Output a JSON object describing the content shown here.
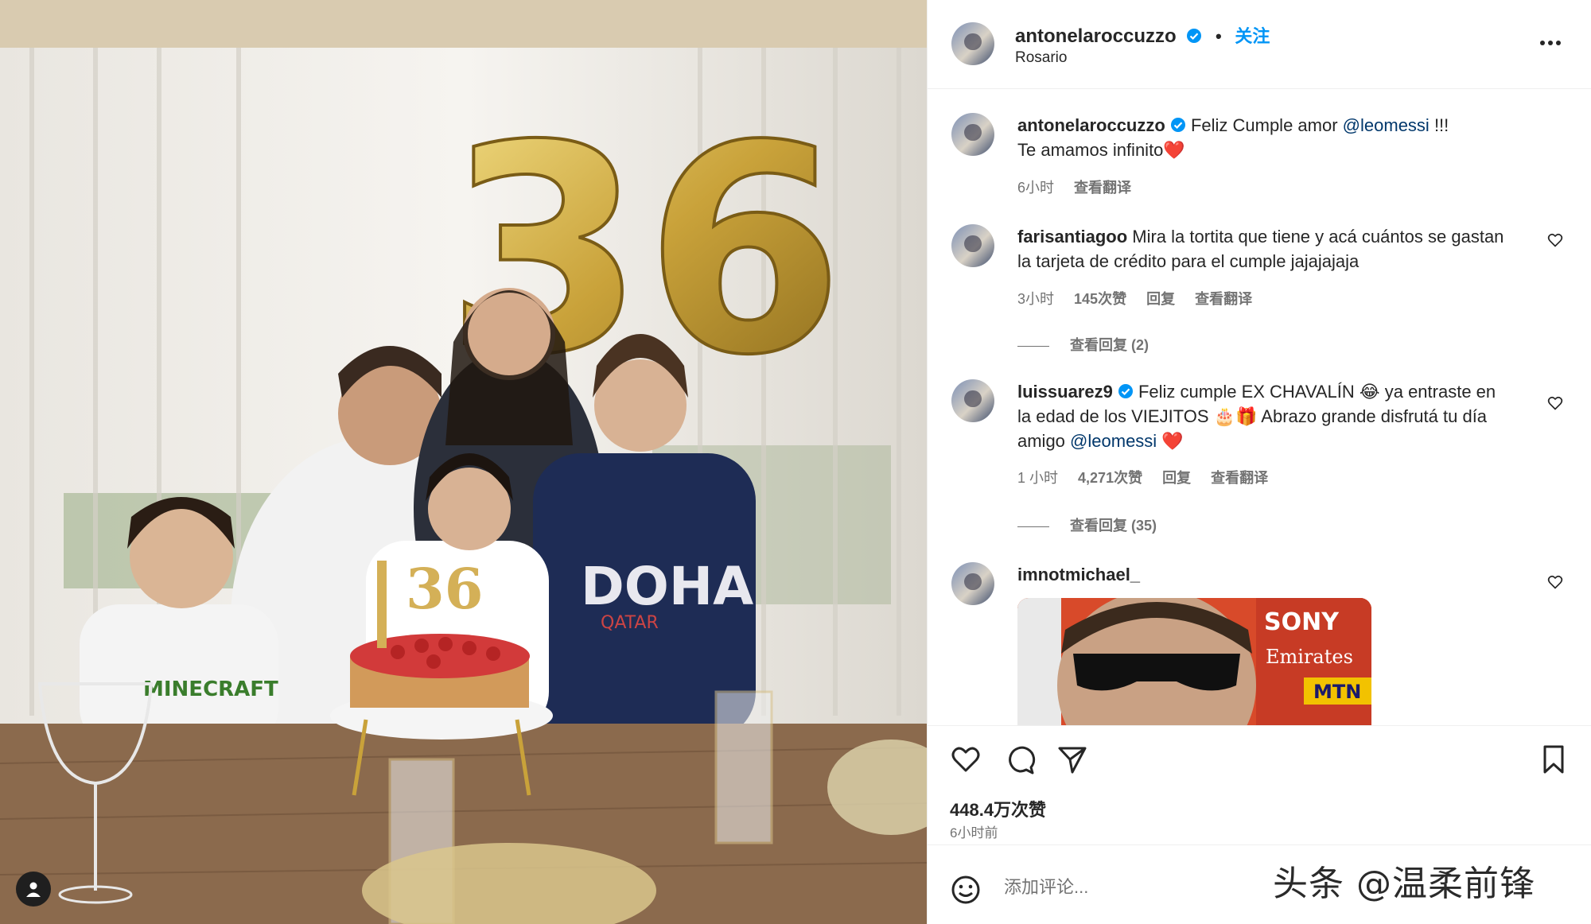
{
  "header": {
    "username": "antonelaroccuzzo",
    "dot": "•",
    "follow_label": "关注",
    "location": "Rosario"
  },
  "caption": {
    "username": "antonelaroccuzzo",
    "text_1": "Feliz Cumple amor",
    "mention": "@leomessi",
    "text_2": "!!!",
    "line_2": "Te amamos infinito❤️",
    "time": "6小时",
    "translate": "查看翻译"
  },
  "comments": [
    {
      "username": "farisantiagoo",
      "text": "Mira la tortita que tiene y acá cuántos se gastan la tarjeta de crédito para el cumple jajajajaja",
      "time": "3小时",
      "likes": "145次赞",
      "reply": "回复",
      "translate": "查看翻译",
      "view_replies": "查看回复 (2)"
    },
    {
      "username": "luissuarez9",
      "text_1": "Feliz cumple EX CHAVALÍN 😂 ya entraste en la edad de los VIEJITOS 🎂🎁 Abrazo grande disfrutá tu día amigo",
      "mention": "@leomessi",
      "text_2": "❤️",
      "time": "1 小时",
      "likes": "4,271次赞",
      "reply": "回复",
      "translate": "查看翻译",
      "view_replies": "查看回复 (35)"
    },
    {
      "username": "imnotmichael_"
    }
  ],
  "image_texts": {
    "balloon_number": "36",
    "cake_topper": "36",
    "shirt_text": "DOHA",
    "shirt_sub": "QATAR",
    "minecraft": "MINECRAFT",
    "gif_sony": "SONY",
    "gif_emirates": "Emirates",
    "gif_mtn": "MTN"
  },
  "actions": {
    "likes": "448.4万次赞",
    "posted": "6小时前"
  },
  "comment_box": {
    "placeholder": "添加评论..."
  },
  "watermark": "头条 @温柔前锋",
  "colors": {
    "link_blue": "#0095f6",
    "verified_blue": "#0095f6",
    "mention_dark": "#00376b",
    "meta_gray": "#737373"
  }
}
